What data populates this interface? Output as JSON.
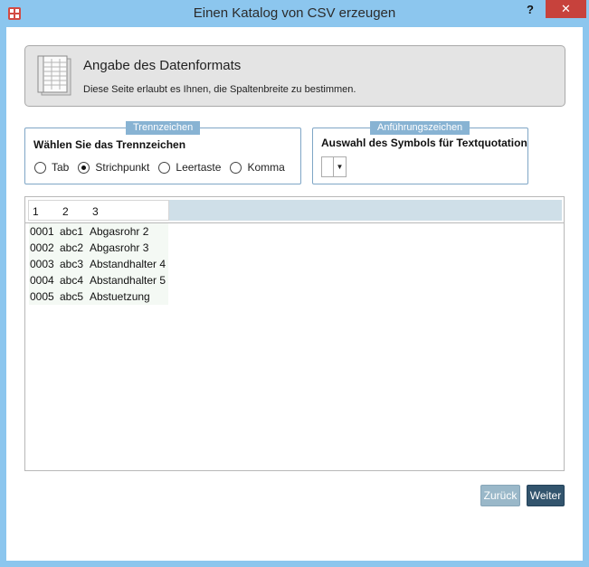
{
  "window": {
    "title": "Einen Katalog von CSV erzeugen",
    "help_label": "?",
    "close_label": "✕"
  },
  "header": {
    "title": "Angabe des Datenformats",
    "subtitle": "Diese Seite erlaubt es Ihnen, die Spaltenbreite zu bestimmen."
  },
  "separator_group": {
    "legend": "Trennzeichen",
    "label": "Wählen Sie das Trennzeichen",
    "options": [
      {
        "label": "Tab",
        "checked": false
      },
      {
        "label": "Strichpunkt",
        "checked": true
      },
      {
        "label": "Leertaste",
        "checked": false
      },
      {
        "label": "Komma",
        "checked": false
      }
    ]
  },
  "quote_group": {
    "legend": "Anführungszeichen",
    "label": "Auswahl des Symbols für Textquotation",
    "selected_value": ""
  },
  "grid": {
    "columns": [
      "1",
      "2",
      "3"
    ],
    "rows": [
      [
        "0001",
        "abc1",
        "Abgasrohr 2"
      ],
      [
        "0002",
        "abc2",
        "Abgasrohr 3"
      ],
      [
        "0003",
        "abc3",
        "Abstandhalter 4"
      ],
      [
        "0004",
        "abc4",
        "Abstandhalter 5"
      ],
      [
        "0005",
        "abc5",
        "Abstuetzung"
      ]
    ]
  },
  "buttons": {
    "back": "Zurück",
    "next": "Weiter"
  },
  "colors": {
    "title_bar": "#8cc6ee",
    "close": "#c7423c",
    "legend": "#88b3d3",
    "next_button": "#32546d",
    "back_button": "#9ab8c9"
  }
}
